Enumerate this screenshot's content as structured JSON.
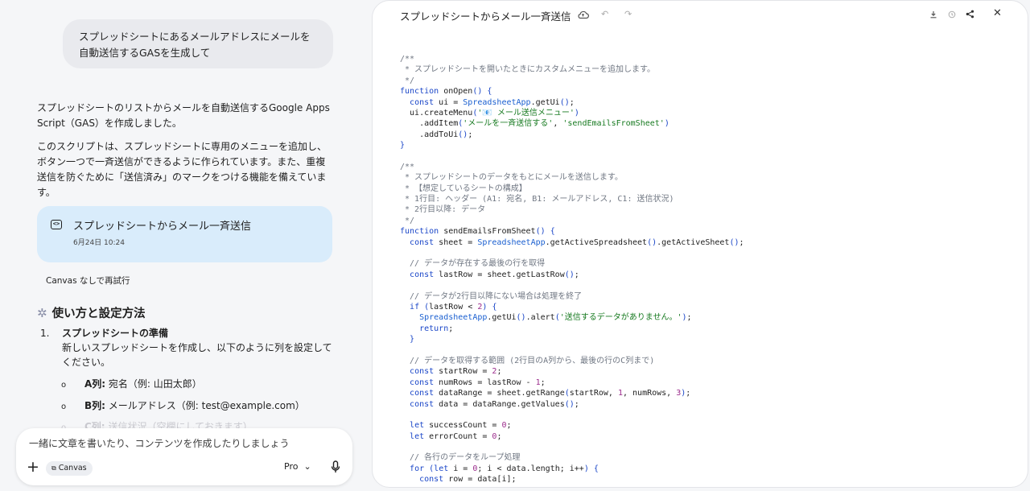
{
  "chat": {
    "user_prompt": "スプレッドシートにあるメールアドレスにメールを自動送信するGASを生成して",
    "intro_paragraph_1": "スプレッドシートのリストからメールを自動送信するGoogle Apps Script（GAS）を作成しました。",
    "intro_paragraph_2": "このスクリプトは、スプレッドシートに専用のメニューを追加し、ボタン一つで一斉送信ができるように作られています。また、重複送信を防ぐために「送信済み」のマークをつける機能を備えています。",
    "canvas_card": {
      "title": "スプレッドシートからメール一斉送信",
      "date": "6月24日 10:24"
    },
    "retry_label": "Canvas なしで再試行",
    "section_heading": "使い方と設定方法",
    "steps": [
      {
        "num": "1.",
        "title": "スプレッドシートの準備",
        "desc": "新しいスプレッドシートを作成し、以下のように列を設定してください。"
      }
    ],
    "bullets": [
      {
        "mark": "o",
        "label": "A列:",
        "text": "宛名（例: 山田太郎）"
      },
      {
        "mark": "o",
        "label": "B列:",
        "text": "メールアドレス（例: test@example.com）"
      },
      {
        "mark": "o",
        "label": "C列:",
        "text": "送信状況（空欄にしておきます）"
      }
    ]
  },
  "composer": {
    "placeholder": "一緒に文章を書いたり、コンテンツを作成したりしましょう",
    "canvas_chip": "Canvas",
    "model_label": "Pro"
  },
  "canvas": {
    "title": "スプレッドシートからメール一斉送信",
    "icons": [
      "cloud-sync-icon",
      "undo-icon",
      "redo-icon",
      "download-icon",
      "history-icon",
      "share-icon",
      "close-icon"
    ]
  },
  "code_lines": [
    "/**",
    " * スプレッドシートを開いたときにカスタムメニューを追加します。",
    " */",
    "function onOpen() {",
    "  const ui = SpreadsheetApp.getUi();",
    "  ui.createMenu('📧 メール送信メニュー')",
    "    .addItem('メールを一斉送信する', 'sendEmailsFromSheet')",
    "    .addToUi();",
    "}",
    "",
    "/**",
    " * スプレッドシートのデータをもとにメールを送信します。",
    " * 【想定しているシートの構成】",
    " * 1行目: ヘッダー (A1: 宛名, B1: メールアドレス, C1: 送信状況)",
    " * 2行目以降: データ",
    " */",
    "function sendEmailsFromSheet() {",
    "  const sheet = SpreadsheetApp.getActiveSpreadsheet().getActiveSheet();",
    "",
    "  // データが存在する最後の行を取得",
    "  const lastRow = sheet.getLastRow();",
    "",
    "  // データが2行目以降にない場合は処理を終了",
    "  if (lastRow < 2) {",
    "    SpreadsheetApp.getUi().alert('送信するデータがありません。');",
    "    return;",
    "  }",
    "",
    "  // データを取得する範囲 (2行目のA列から、最後の行のC列まで)",
    "  const startRow = 2;",
    "  const numRows = lastRow - 1;",
    "  const dataRange = sheet.getRange(startRow, 1, numRows, 3);",
    "  const data = dataRange.getValues();",
    "",
    "  let successCount = 0;",
    "  let errorCount = 0;",
    "",
    "  // 各行のデータをループ処理",
    "  for (let i = 0; i < data.length; i++) {",
    "    const row = data[i];"
  ]
}
